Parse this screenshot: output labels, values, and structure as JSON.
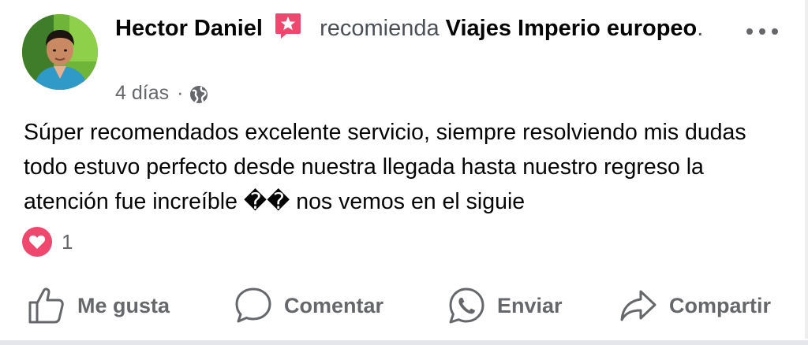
{
  "post": {
    "author": "Hector Daniel",
    "verb": "recomienda",
    "page_name": "Viajes Imperio europeo",
    "period": ".",
    "time": "4 días",
    "separator": "·",
    "body": "Súper recomendados excelente servicio, siempre resolviendo mis dudas todo estuvo perfecto desde nuestra llegada hasta nuestro regreso la atención fue increíble �� nos vemos en el siguie",
    "reaction_count": "1"
  },
  "actions": {
    "like": "Me gusta",
    "comment": "Comentar",
    "send": "Enviar",
    "share": "Compartir"
  },
  "icons": {
    "recommend_badge": "star-badge-icon",
    "privacy": "globe-icon",
    "menu": "more-options-icon",
    "reaction": "heart-icon"
  },
  "colors": {
    "text": "#050505",
    "secondary": "#65676b",
    "recommend_badge": "#f0476e",
    "love_reaction": "#f0476e"
  }
}
